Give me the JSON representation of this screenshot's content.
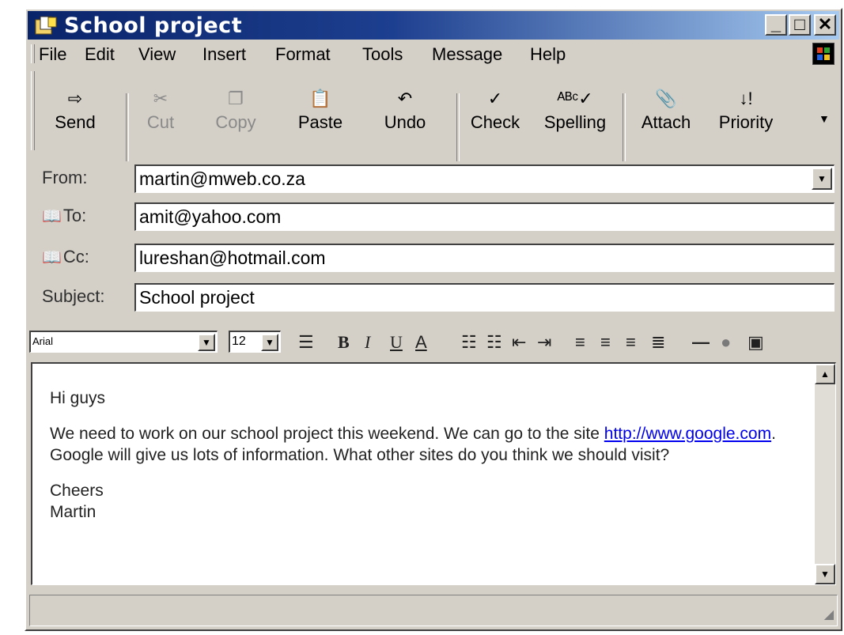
{
  "window": {
    "title": "School project"
  },
  "menu": [
    "File",
    "Edit",
    "View",
    "Insert",
    "Format",
    "Tools",
    "Message",
    "Help"
  ],
  "toolbar": {
    "send": "Send",
    "cut": "Cut",
    "copy": "Copy",
    "paste": "Paste",
    "undo": "Undo",
    "check": "Check",
    "spelling": "Spelling",
    "attach": "Attach",
    "priority": "Priority"
  },
  "header": {
    "from_label": "From:",
    "from_value": "martin@mweb.co.za",
    "to_label": "To:",
    "to_value": "amit@yahoo.com",
    "cc_label": "Cc:",
    "cc_value": "lureshan@hotmail.com",
    "subject_label": "Subject:",
    "subject_value": "School project"
  },
  "format": {
    "font": "Arial",
    "size": "12"
  },
  "message": {
    "greeting": "Hi guys",
    "line1": "We need to work on our school project this weekend. We can go to the site",
    "link": "http://www.google.com",
    "line2": ". Google will give us lots of information. What other sites do you think we should visit?",
    "closing": "Cheers",
    "signature": "Martin"
  }
}
